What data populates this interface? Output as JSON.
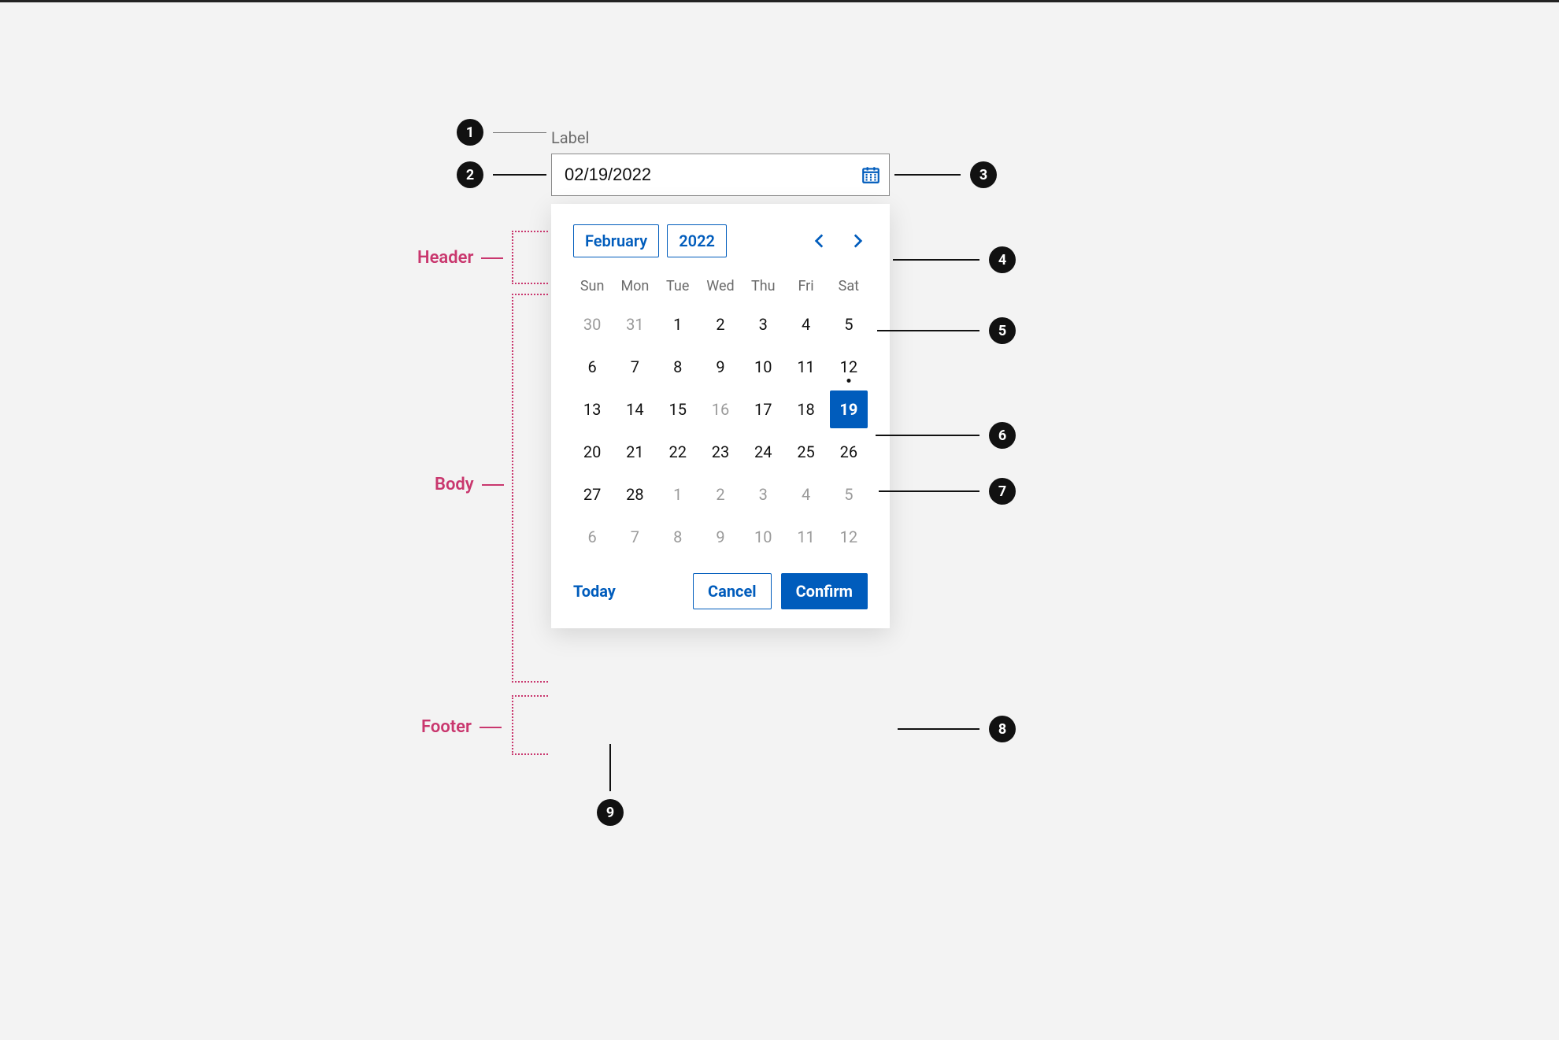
{
  "label": "Label",
  "input_value": "02/19/2022",
  "header": {
    "month": "February",
    "year": "2022"
  },
  "dow": [
    "Sun",
    "Mon",
    "Tue",
    "Wed",
    "Thu",
    "Fri",
    "Sat"
  ],
  "days": [
    [
      30,
      "out"
    ],
    [
      31,
      "out"
    ],
    [
      1,
      ""
    ],
    [
      2,
      ""
    ],
    [
      3,
      ""
    ],
    [
      4,
      ""
    ],
    [
      5,
      ""
    ],
    [
      6,
      ""
    ],
    [
      7,
      ""
    ],
    [
      8,
      ""
    ],
    [
      9,
      ""
    ],
    [
      10,
      ""
    ],
    [
      11,
      ""
    ],
    [
      12,
      "today"
    ],
    [
      13,
      ""
    ],
    [
      14,
      ""
    ],
    [
      15,
      ""
    ],
    [
      16,
      "dim"
    ],
    [
      17,
      ""
    ],
    [
      18,
      ""
    ],
    [
      19,
      "sel"
    ],
    [
      20,
      ""
    ],
    [
      21,
      ""
    ],
    [
      22,
      ""
    ],
    [
      23,
      ""
    ],
    [
      24,
      ""
    ],
    [
      25,
      ""
    ],
    [
      26,
      ""
    ],
    [
      27,
      ""
    ],
    [
      28,
      ""
    ],
    [
      1,
      "out"
    ],
    [
      2,
      "out"
    ],
    [
      3,
      "out"
    ],
    [
      4,
      "out"
    ],
    [
      5,
      "out"
    ],
    [
      6,
      "out"
    ],
    [
      7,
      "out"
    ],
    [
      8,
      "out"
    ],
    [
      9,
      "out"
    ],
    [
      10,
      "out"
    ],
    [
      11,
      "out"
    ],
    [
      12,
      "out"
    ]
  ],
  "footer": {
    "today": "Today",
    "cancel": "Cancel",
    "confirm": "Confirm"
  },
  "sections": {
    "header": "Header",
    "body": "Body",
    "footer": "Footer"
  },
  "callouts": {
    "1": "1",
    "2": "2",
    "3": "3",
    "4": "4",
    "5": "5",
    "6": "6",
    "7": "7",
    "8": "8",
    "9": "9"
  }
}
